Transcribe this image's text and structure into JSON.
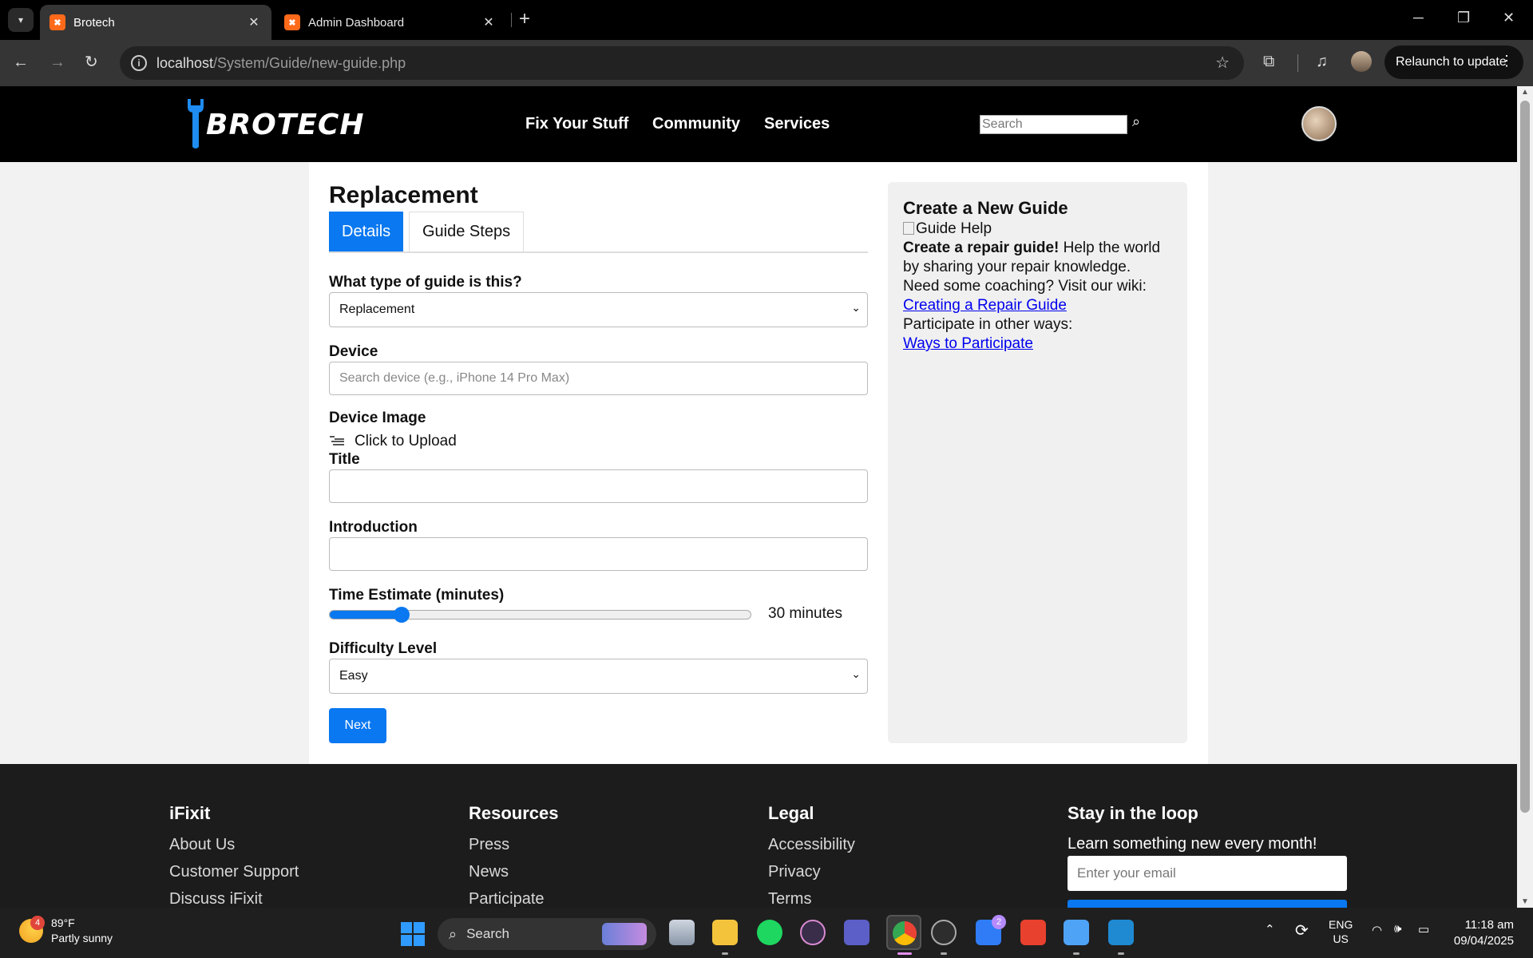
{
  "browser": {
    "tabs": [
      {
        "title": "Brotech",
        "active": true
      },
      {
        "title": "Admin Dashboard",
        "active": false
      }
    ],
    "url_host": "localhost",
    "url_path": "/System/Guide/new-guide.php",
    "relaunch_label": "Relaunch to update"
  },
  "site": {
    "logo_text": "BROTECH",
    "nav": [
      "Fix Your Stuff",
      "Community",
      "Services"
    ],
    "search_placeholder": "Search"
  },
  "form": {
    "page_title": "Replacement",
    "tabs": [
      "Details",
      "Guide Steps"
    ],
    "guide_type_label": "What type of guide is this?",
    "guide_type_value": "Replacement",
    "device_label": "Device",
    "device_placeholder": "Search device (e.g., iPhone 14 Pro Max)",
    "device_image_label": "Device Image",
    "upload_label": "Click to Upload",
    "title_label": "Title",
    "title_value": "",
    "intro_label": "Introduction",
    "intro_value": "",
    "time_label": "Time Estimate (minutes)",
    "time_fraction": 0.17,
    "time_value_text": "30 minutes",
    "difficulty_label": "Difficulty Level",
    "difficulty_value": "Easy",
    "next_label": "Next"
  },
  "sidebar": {
    "title": "Create a New Guide",
    "image_alt": "Guide Help",
    "lead_bold": "Create a repair guide!",
    "lead_rest_1": " Help the world",
    "lead_rest_2": "by sharing your repair knowledge.",
    "wiki_text": "Need some coaching? Visit our wiki:",
    "wiki_link": "Creating a Repair Guide",
    "participate_text": "Participate in other ways:",
    "participate_link": "Ways to Participate"
  },
  "footer": {
    "col1": {
      "heading": "iFixit",
      "links": [
        "About Us",
        "Customer Support",
        "Discuss iFixit"
      ]
    },
    "col2": {
      "heading": "Resources",
      "links": [
        "Press",
        "News",
        "Participate"
      ]
    },
    "col3": {
      "heading": "Legal",
      "links": [
        "Accessibility",
        "Privacy",
        "Terms"
      ]
    },
    "col4": {
      "heading": "Stay in the loop",
      "subtitle": "Learn something new every month!",
      "email_placeholder": "Enter your email"
    }
  },
  "taskbar": {
    "weather_temp": "89°F",
    "weather_desc": "Partly sunny",
    "weather_badge": "4",
    "search_label": "Search",
    "todo_badge": "2",
    "lang_1": "ENG",
    "lang_2": "US",
    "time": "11:18 am",
    "date": "09/04/2025"
  },
  "colors": {
    "accent": "#0a78f0",
    "header_bg": "#000000",
    "footer_bg": "#1c1c1c"
  }
}
